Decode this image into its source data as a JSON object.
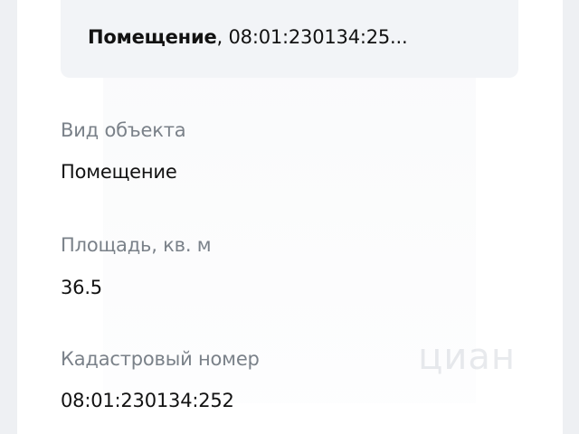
{
  "summary": {
    "kind": "Помещение",
    "rest": ", 08:01:230134:25..."
  },
  "fields": [
    {
      "label": "Вид объекта",
      "value": "Помещение"
    },
    {
      "label": "Площадь, кв. м",
      "value": "36.5"
    },
    {
      "label": "Кадастровый номер",
      "value": "08:01:230134:252"
    }
  ],
  "watermark": "циан"
}
